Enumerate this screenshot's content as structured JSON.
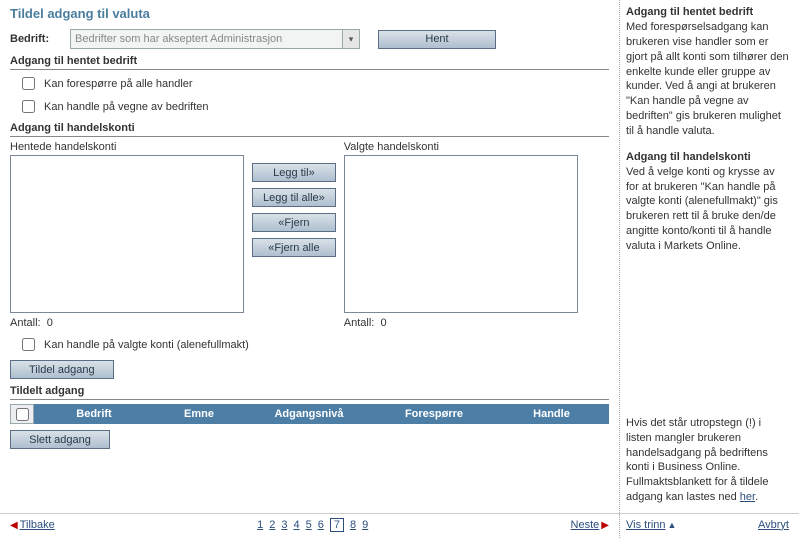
{
  "title": "Tildel adgang til valuta",
  "bedrift": {
    "label": "Bedrift:",
    "selected": "Bedrifter som har akseptert Administrasjon",
    "hent": "Hent"
  },
  "hentet": {
    "header": "Adgang til hentet bedrift",
    "chk1": "Kan forespørre på alle handler",
    "chk2": "Kan handle på vegne av bedriften"
  },
  "handelskonti": {
    "header": "Adgang til handelskonti",
    "left_label": "Hentede handelskonti",
    "right_label": "Valgte handelskonti",
    "add": "Legg til»",
    "add_all": "Legg til alle»",
    "remove": "«Fjern",
    "remove_all": "«Fjern alle",
    "count_label": "Antall:",
    "left_count": "0",
    "right_count": "0",
    "chk3": "Kan handle på valgte konti (alenefullmakt)",
    "assign": "Tildel adgang"
  },
  "assigned": {
    "header": "Tildelt adgang",
    "cols": {
      "bedrift": "Bedrift",
      "emne": "Emne",
      "nivaa": "Adgangsnivå",
      "foresporre": "Forespørre",
      "handle": "Handle"
    },
    "delete": "Slett adgang"
  },
  "sidebar": {
    "h1": "Adgang til hentet bedrift",
    "p1": "Med forespørselsadgang kan brukeren vise handler som er gjort på allt konti som tilhører den enkelte kunde eller gruppe av kunder. Ved å angi at brukeren \"Kan handle på vegne av bedriften\" gis brukeren mulighet til å handle valuta.",
    "h2": "Adgang til handelskonti",
    "p2": "Ved å velge konti og krysse av for at brukeren \"Kan handle på valgte konti (alenefullmakt)\" gis brukeren rett til å bruke den/de angitte konto/konti til å handle valuta i Markets Online.",
    "p3a": "Hvis det står utropstegn (!) i listen mangler brukeren handelsadgang på bedriftens konti i Business Online. Fullmaktsblankett for å tildele adgang kan lastes ned ",
    "p3link": "her",
    "p3b": "."
  },
  "footer": {
    "back": "Tilbake",
    "next": "Neste",
    "pages": [
      "1",
      "2",
      "3",
      "4",
      "5",
      "6",
      "7",
      "8",
      "9"
    ],
    "current": "7",
    "show_steps": "Vis trinn",
    "cancel": "Avbryt"
  }
}
